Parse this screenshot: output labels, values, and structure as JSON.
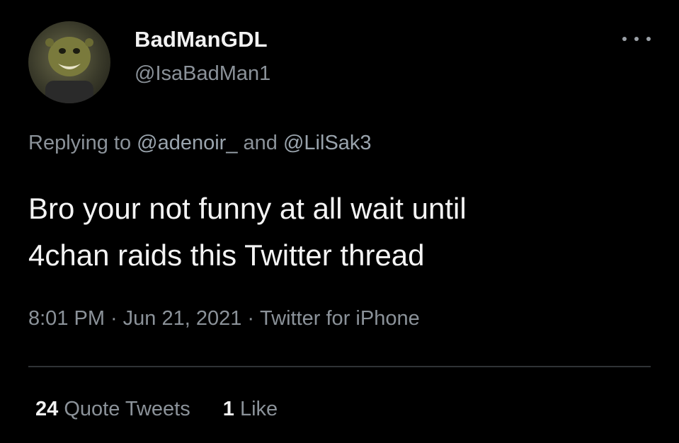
{
  "author": {
    "display_name": "BadManGDL",
    "handle": "@IsaBadMan1"
  },
  "reply": {
    "prefix": "Replying to",
    "mention_1": "@adenoir_",
    "joiner": "and",
    "mention_2": "@LilSak3"
  },
  "tweet": {
    "line_1": "Bro your not funny at all wait until",
    "line_2": "4chan raids this Twitter thread"
  },
  "meta": {
    "time": "8:01 PM",
    "separator": "·",
    "date": "Jun 21, 2021",
    "source": "Twitter for iPhone"
  },
  "stats": {
    "quote_count": "24",
    "quote_label": "Quote Tweets",
    "like_count": "1",
    "like_label": "Like"
  },
  "icons": {
    "more": "more-options-icon",
    "avatar": "avatar"
  },
  "colors": {
    "background": "#000000",
    "primary_text": "#f4f4f4",
    "secondary_text": "#8b9299",
    "divider": "#2f3336"
  }
}
